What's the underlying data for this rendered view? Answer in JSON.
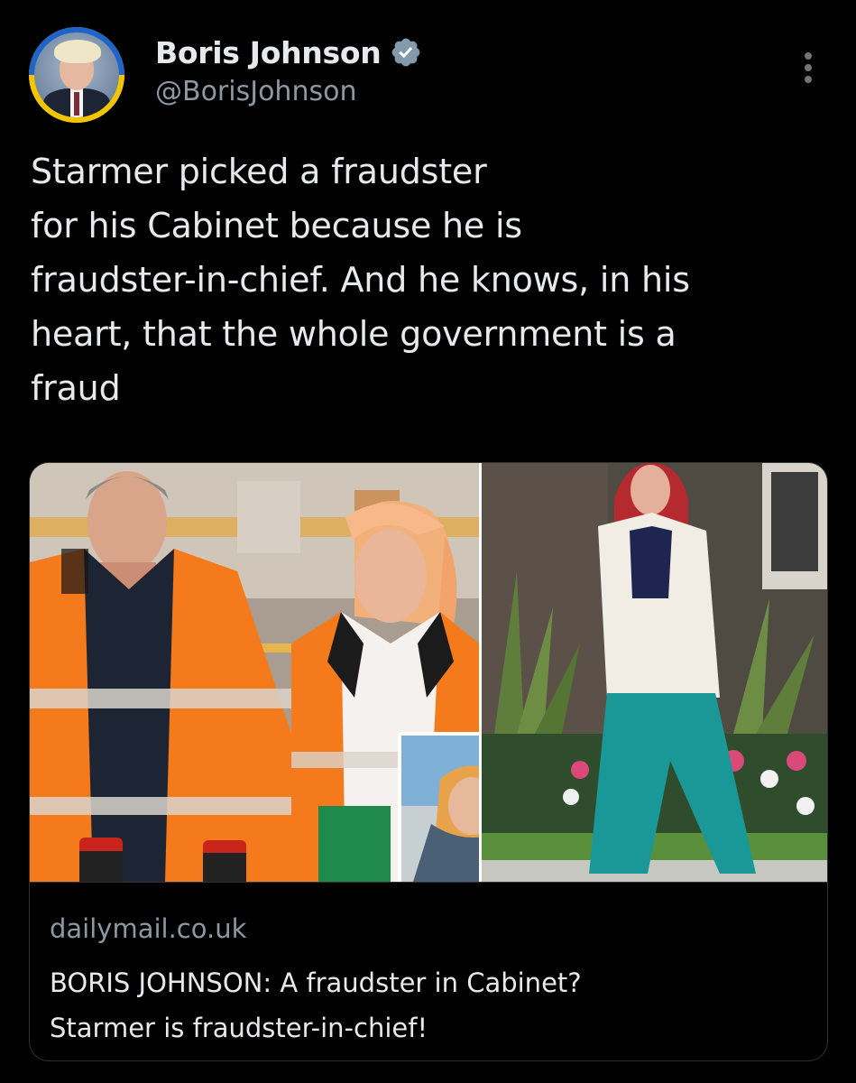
{
  "author": {
    "display_name": "Boris Johnson",
    "handle": "@BorisJohnson",
    "verified": true,
    "avatar_ring_colors": [
      "#1f64c8",
      "#f2c500"
    ]
  },
  "tweet": {
    "text": "Starmer picked a fraudster\nfor his Cabinet because he is\nfraudster-in-chief. And he knows, in his\nheart, that the whole government is a\nfraud"
  },
  "link_card": {
    "domain": "dailymail.co.uk",
    "title": "BORIS JOHNSON: A fraudster in Cabinet?\nStarmer is fraudster-in-chief!"
  },
  "icons": {
    "verified": "verified-badge-icon",
    "more": "more-options-icon"
  },
  "colors": {
    "background": "#000000",
    "text_primary": "#e7e9ea",
    "text_secondary": "#8b98a5",
    "verified_badge": "#829aab",
    "border": "#2f3336"
  }
}
